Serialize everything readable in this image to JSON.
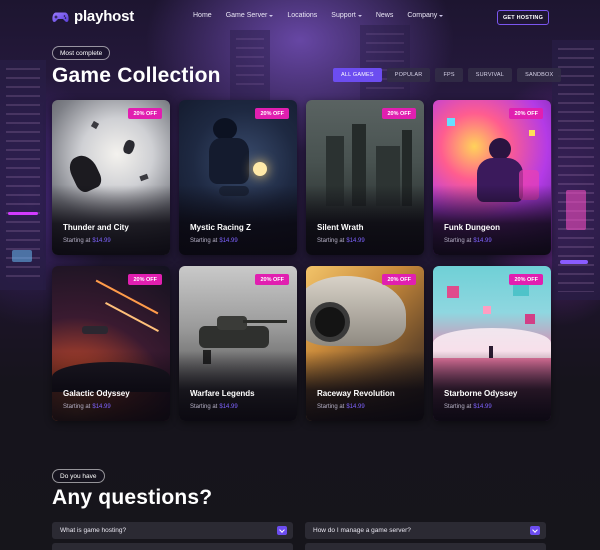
{
  "brand": {
    "name": "playhost",
    "accent": "#6c4df0",
    "badge_color": "#e11fb0"
  },
  "nav": {
    "items": [
      "Home",
      "Game Server",
      "Locations",
      "Support",
      "News",
      "Company"
    ],
    "cta_label": "GET HOSTING"
  },
  "collection": {
    "eyebrow": "Most complete",
    "title": "Game Collection",
    "filters": [
      "ALL GAMES",
      "POPULAR",
      "FPS",
      "SURVIVAL",
      "SANDBOX"
    ],
    "active_filter": "ALL GAMES",
    "price_prefix": "Starting at",
    "games": [
      {
        "title": "Thunder and City",
        "price": "$14.99",
        "badge": "20% OFF",
        "art": "space-skydivers"
      },
      {
        "title": "Mystic Racing Z",
        "price": "$14.99",
        "badge": "20% OFF",
        "art": "motorbike-rider"
      },
      {
        "title": "Silent Wrath",
        "price": "$14.99",
        "badge": "20% OFF",
        "art": "misty-ruins"
      },
      {
        "title": "Funk Dungeon",
        "price": "$14.99",
        "badge": "20% OFF",
        "art": "neon-gamer"
      },
      {
        "title": "Galactic Odyssey",
        "price": "$14.99",
        "badge": "20% OFF",
        "art": "spaceship-battle"
      },
      {
        "title": "Warfare Legends",
        "price": "$14.99",
        "badge": "20% OFF",
        "art": "battle-tank"
      },
      {
        "title": "Raceway Revolution",
        "price": "$14.99",
        "badge": "20% OFF",
        "art": "sports-car"
      },
      {
        "title": "Starborne Odyssey",
        "price": "$14.99",
        "badge": "20% OFF",
        "art": "floating-cubes"
      }
    ]
  },
  "faq": {
    "eyebrow": "Do you have",
    "title": "Any questions?",
    "questions": [
      "What is game hosting?",
      "How do I manage a game server?"
    ]
  }
}
